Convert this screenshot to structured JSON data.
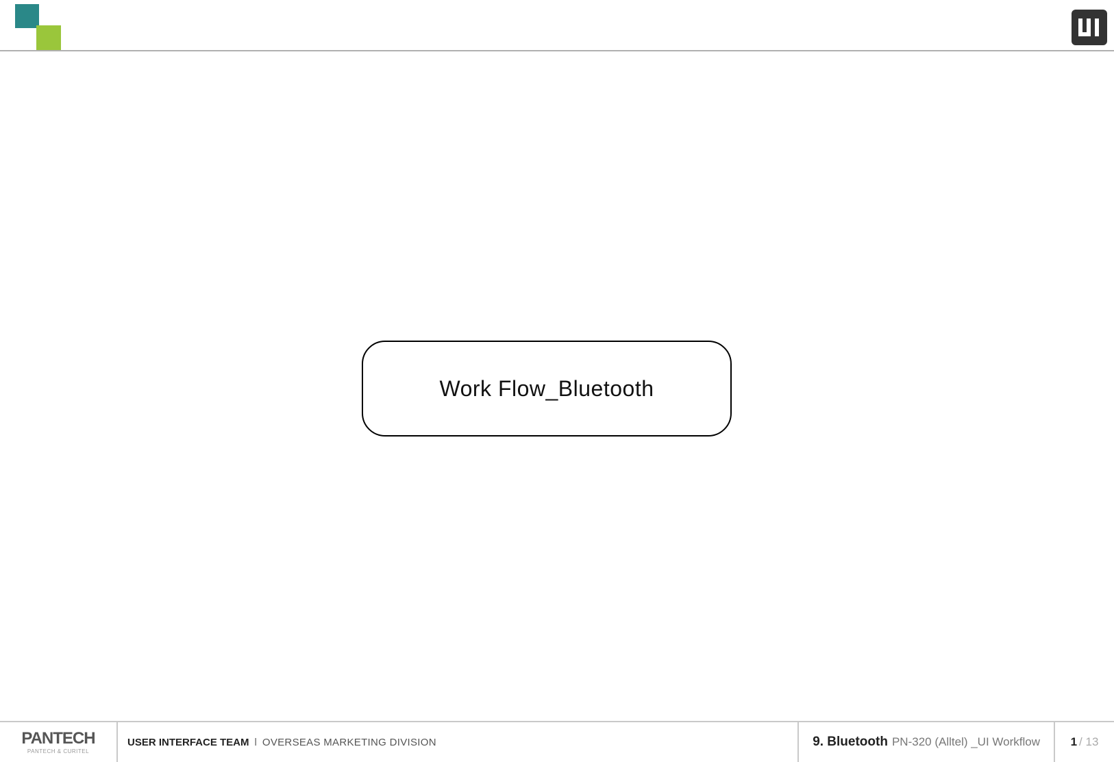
{
  "header": {
    "badge_label": "UI"
  },
  "main": {
    "title": "Work Flow_Bluetooth"
  },
  "footer": {
    "logo": {
      "brand": "PANTECH",
      "sub": "PANTECH & CURITEL"
    },
    "team_bold": "USER INTERFACE TEAM",
    "team_separator": "l",
    "team_division": "OVERSEAS MARKETING DIVISION",
    "section_number": "9. Bluetooth",
    "section_sub": "PN-320 (Alltel) _UI Workflow",
    "page_current": "1",
    "page_total": "/ 13"
  }
}
